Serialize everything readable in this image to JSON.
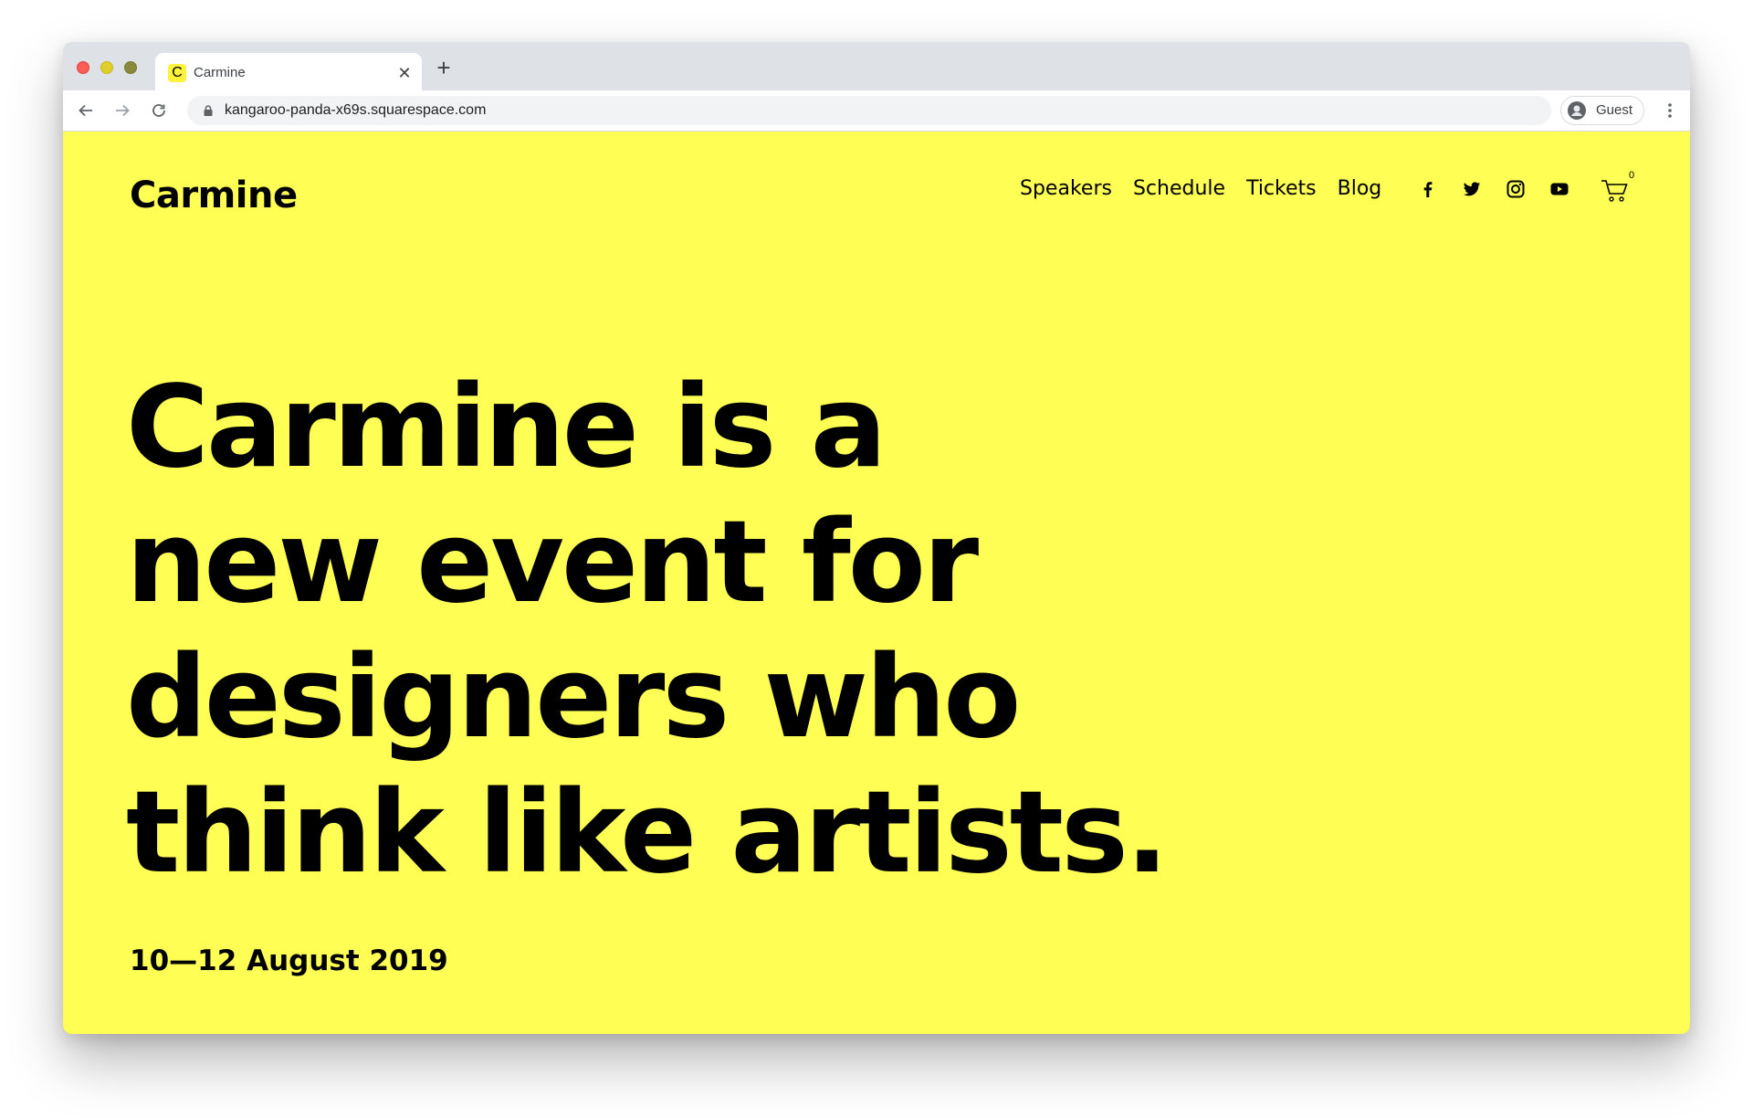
{
  "browser": {
    "tab": {
      "favicon_letter": "C",
      "title": "Carmine"
    },
    "url": "kangaroo-panda-x69s.squarespace.com",
    "profile_label": "Guest"
  },
  "site": {
    "logo": "Carmine",
    "nav": [
      {
        "label": "Speakers"
      },
      {
        "label": "Schedule"
      },
      {
        "label": "Tickets"
      },
      {
        "label": "Blog"
      }
    ],
    "social_icons": [
      "facebook-icon",
      "twitter-icon",
      "instagram-icon",
      "youtube-icon"
    ],
    "cart_count": "0",
    "headline_lines": [
      "Carmine is a",
      "new event for",
      "designers who",
      "think like artists."
    ],
    "dates": "10—12 August 2019",
    "colors": {
      "background": "#fefe54",
      "text": "#000000"
    }
  }
}
